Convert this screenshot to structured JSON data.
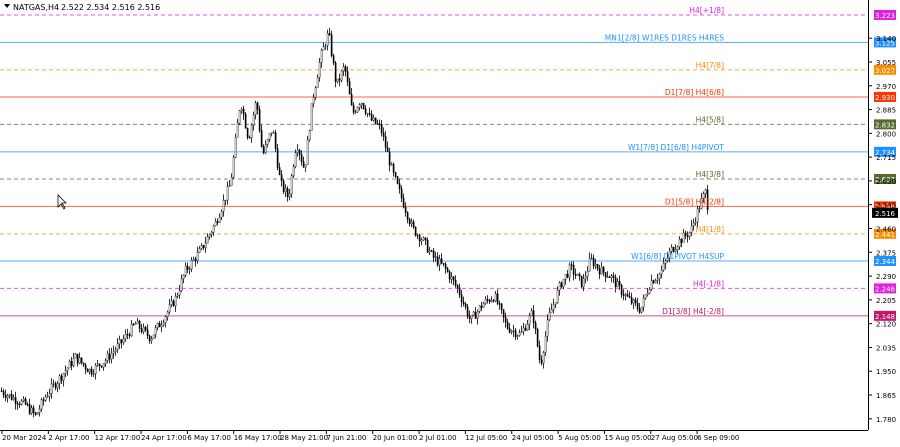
{
  "header": {
    "symbol": "NATGAS,H4",
    "ohlc": "2.522 2.534 2.516 2.516",
    "menu_icon": "triangle-down-icon"
  },
  "colors": {
    "background": "#ffffff",
    "candles": "#000000",
    "axis": "#000000",
    "magenta": "#e020e0",
    "blue": "#1e90ff",
    "orange": "#ff8c00",
    "red": "#ff3300",
    "olive": "#556b2f",
    "crimson": "#c0186a",
    "gray": "#9a9a9a"
  },
  "chart_data": {
    "type": "candlestick",
    "title": "NATGAS,H4",
    "ylim": [
      1.74,
      3.23
    ],
    "y_ticks": [
      "3.140",
      "3.055",
      "2.970",
      "2.885",
      "2.800",
      "2.715",
      "2.630",
      "2.545",
      "2.460",
      "2.375",
      "2.290",
      "2.205",
      "2.120",
      "2.035",
      "1.950",
      "1.865",
      "1.780"
    ],
    "x_tick_labels": [
      "20 Mar 2024",
      "2 Apr 17:00",
      "12 Apr 17:00",
      "24 Apr 17:00",
      "6 May 17:00",
      "16 May 17:00",
      "28 May 21:00",
      "7 Jun 21:00",
      "20 Jun 01:00",
      "2 Jul 01:00",
      "12 Jul 05:00",
      "24 Jul 05:00",
      "5 Aug 05:00",
      "15 Aug 05:00",
      "27 Aug 05:00",
      "6 Sep 09:00"
    ],
    "price_path": [
      [
        0,
        1.88
      ],
      [
        10,
        1.86
      ],
      [
        25,
        1.83
      ],
      [
        35,
        1.79
      ],
      [
        45,
        1.86
      ],
      [
        60,
        1.93
      ],
      [
        75,
        2.0
      ],
      [
        90,
        1.95
      ],
      [
        105,
        1.99
      ],
      [
        120,
        2.05
      ],
      [
        135,
        2.12
      ],
      [
        150,
        2.07
      ],
      [
        165,
        2.15
      ],
      [
        175,
        2.21
      ],
      [
        185,
        2.31
      ],
      [
        200,
        2.38
      ],
      [
        215,
        2.48
      ],
      [
        230,
        2.62
      ],
      [
        240,
        2.92
      ],
      [
        248,
        2.78
      ],
      [
        256,
        2.92
      ],
      [
        262,
        2.72
      ],
      [
        272,
        2.82
      ],
      [
        280,
        2.62
      ],
      [
        288,
        2.57
      ],
      [
        296,
        2.77
      ],
      [
        304,
        2.67
      ],
      [
        312,
        2.92
      ],
      [
        320,
        3.07
      ],
      [
        328,
        3.16
      ],
      [
        336,
        2.97
      ],
      [
        344,
        3.04
      ],
      [
        352,
        2.87
      ],
      [
        360,
        2.92
      ],
      [
        370,
        2.85
      ],
      [
        380,
        2.82
      ],
      [
        392,
        2.66
      ],
      [
        402,
        2.56
      ],
      [
        412,
        2.46
      ],
      [
        422,
        2.42
      ],
      [
        432,
        2.36
      ],
      [
        444,
        2.32
      ],
      [
        458,
        2.24
      ],
      [
        470,
        2.13
      ],
      [
        482,
        2.19
      ],
      [
        494,
        2.22
      ],
      [
        506,
        2.11
      ],
      [
        520,
        2.08
      ],
      [
        532,
        2.16
      ],
      [
        540,
        1.97
      ],
      [
        548,
        2.14
      ],
      [
        560,
        2.26
      ],
      [
        570,
        2.32
      ],
      [
        582,
        2.26
      ],
      [
        590,
        2.35
      ],
      [
        600,
        2.31
      ],
      [
        610,
        2.29
      ],
      [
        620,
        2.24
      ],
      [
        630,
        2.2
      ],
      [
        640,
        2.17
      ],
      [
        650,
        2.27
      ],
      [
        660,
        2.3
      ],
      [
        670,
        2.38
      ],
      [
        680,
        2.42
      ],
      [
        690,
        2.45
      ],
      [
        700,
        2.55
      ],
      [
        705,
        2.59
      ],
      [
        708,
        2.52
      ]
    ],
    "levels": [
      {
        "label": "H4[+1/8]",
        "value": "3.223",
        "color": "magenta",
        "dash": true
      },
      {
        "label": "MN1[2/8] W1RES D1RES H4RES",
        "value": "3.125",
        "color": "blue",
        "dash": false
      },
      {
        "label": "H4[7/8]",
        "value": "3.027",
        "color": "orange",
        "dash": true
      },
      {
        "label": "D1[7/8] H4[6/8]",
        "value": "2.930",
        "color": "red",
        "dash": false
      },
      {
        "label": "H4[5/8]",
        "value": "2.832",
        "color": "olive",
        "dash": true
      },
      {
        "label": "W1[7/8] D1[6/8] H4PIVOT",
        "value": "2.734",
        "color": "blue",
        "dash": false
      },
      {
        "label": "H4[3/8]",
        "value": "2.637",
        "color": "olive",
        "dash": true
      },
      {
        "label": "D1[5/8] H4[2/8]",
        "value": "2.539",
        "color": "red",
        "dash": false
      },
      {
        "label": "H4[1/8]",
        "value": "2.441",
        "color": "orange",
        "dash": true
      },
      {
        "label": "W1[6/8] D1PIVOT H4SUP",
        "value": "2.344",
        "color": "blue",
        "dash": false
      },
      {
        "label": "H4[-1/8]",
        "value": "2.246",
        "color": "magenta",
        "dash": true
      },
      {
        "label": "D1[3/8] H4[-2/8]",
        "value": "2.148",
        "color": "crimson",
        "dash": false
      }
    ],
    "current_price": "2.516",
    "grid": false
  }
}
